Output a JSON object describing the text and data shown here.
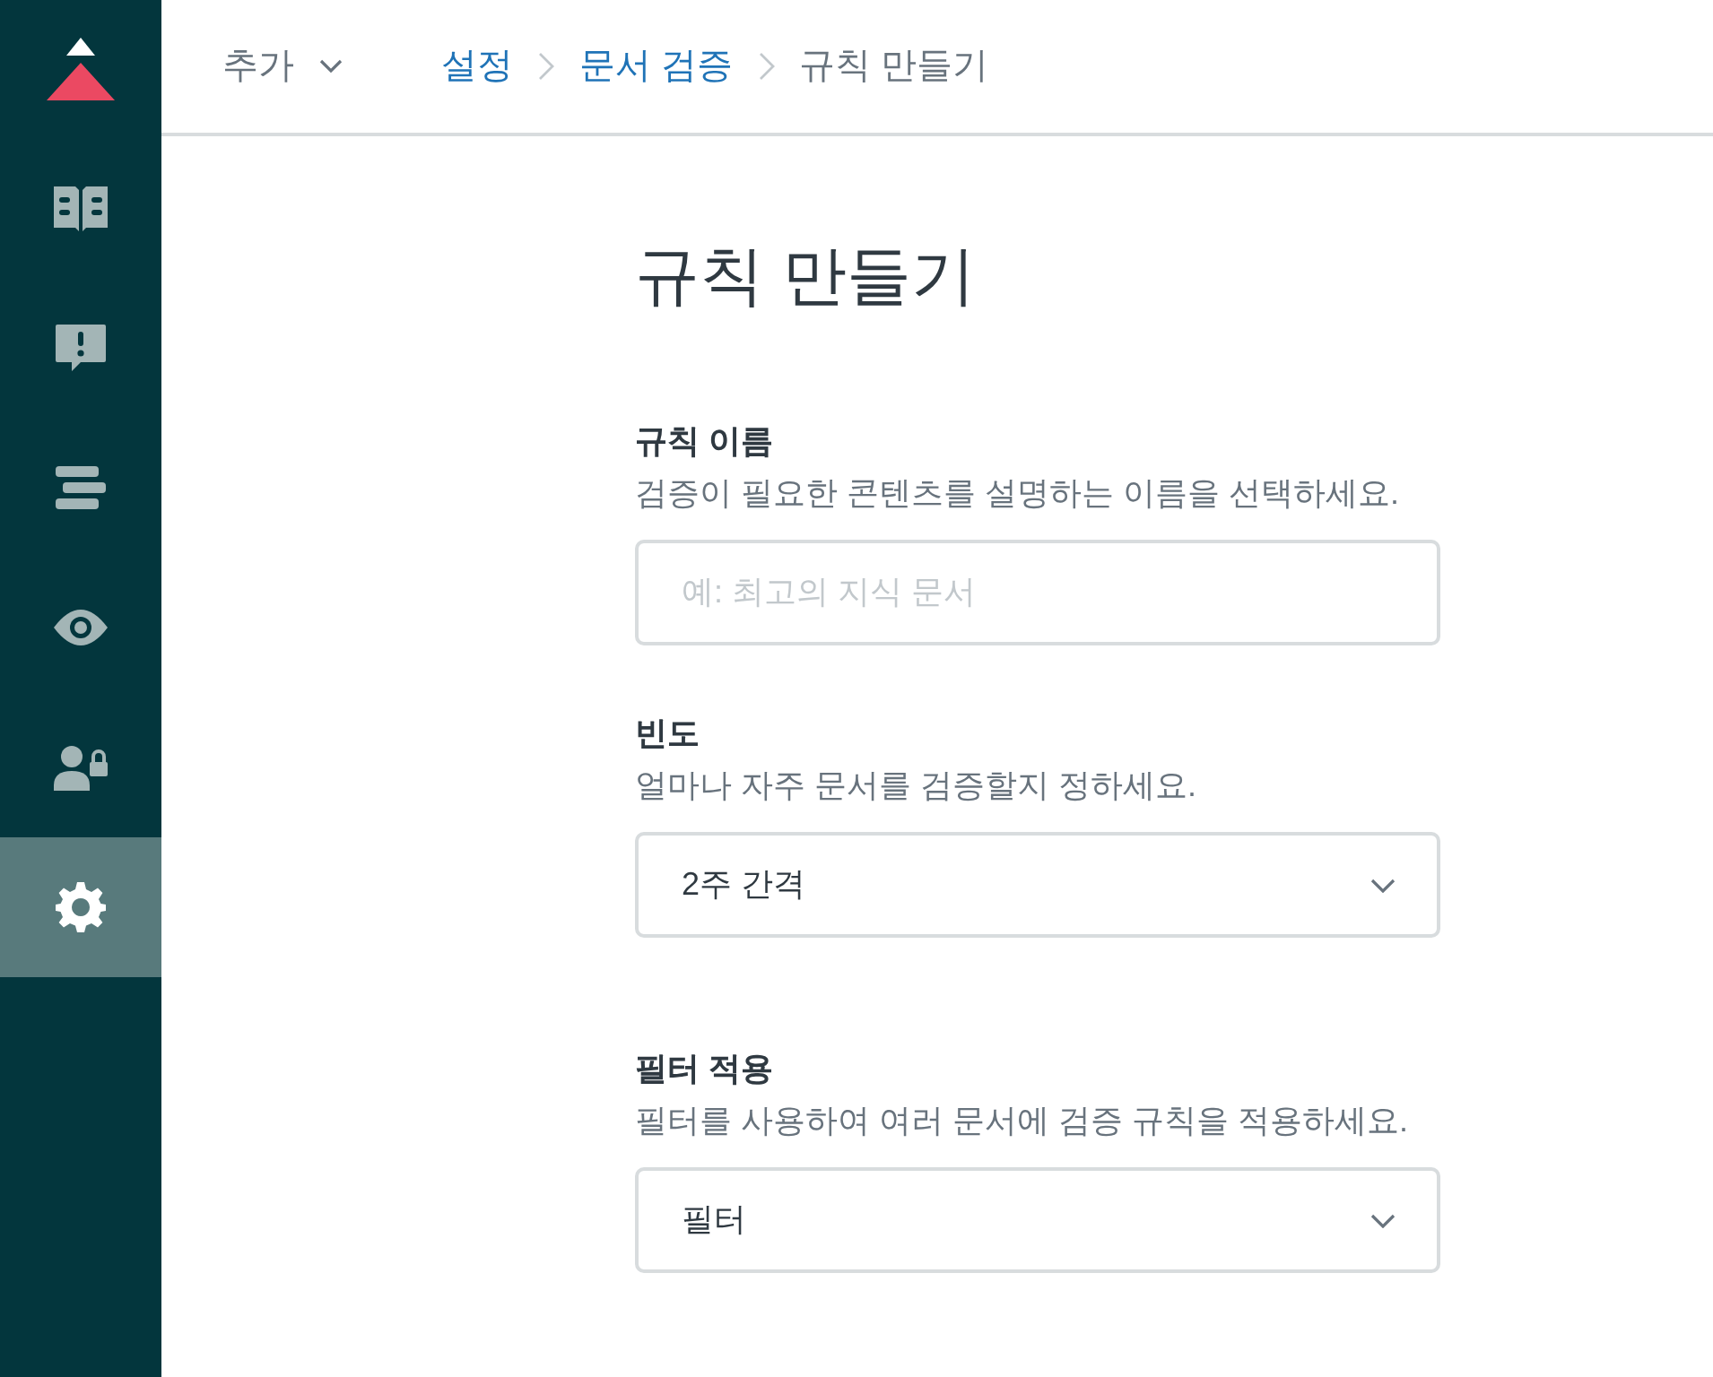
{
  "sidebar": {
    "items": [
      {
        "selected": false
      },
      {
        "selected": false
      },
      {
        "selected": false
      },
      {
        "selected": false
      },
      {
        "selected": false
      },
      {
        "selected": true
      }
    ]
  },
  "header": {
    "add_menu": {
      "label": "추가"
    },
    "breadcrumb": [
      {
        "label": "설정",
        "current": false
      },
      {
        "label": "문서 검증",
        "current": false
      },
      {
        "label": "규칙 만들기",
        "current": true
      }
    ]
  },
  "page_title": "규칙 만들기",
  "fields": [
    {
      "kind": "text",
      "label": "규칙 이름",
      "description": "검증이 필요한 콘텐츠를 설명하는 이름을 선택하세요.",
      "placeholder": "예: 최고의 지식 문서"
    },
    {
      "kind": "select",
      "label": "빈도",
      "description": "얼마나 자주 문서를 검증할지 정하세요.",
      "value": "2주 간격"
    },
    {
      "kind": "select",
      "label": "필터 적용",
      "description": "필터를 사용하여 여러 문서에 검증 규칙을 적용하세요.",
      "value": "필터"
    }
  ]
}
